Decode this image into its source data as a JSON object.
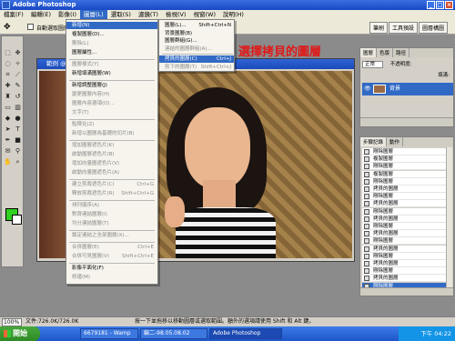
{
  "window": {
    "title": "Adobe Photoshop"
  },
  "menubar": [
    "檔案(F)",
    "編輯(E)",
    "影像(I)",
    "圖層(L)",
    "選取(S)",
    "濾鏡(T)",
    "檢視(V)",
    "視窗(W)",
    "說明(H)"
  ],
  "options": {
    "auto_select_label": "自動選取圖層",
    "tabs": [
      "筆刷",
      "工具預設",
      "圖層構圖"
    ]
  },
  "document": {
    "title": "範例 @ 100% (背景, RGB)"
  },
  "layer_menu": {
    "items": [
      {
        "label": "新增(N)",
        "shortcut": "",
        "state": "hi"
      },
      {
        "label": "複製圖層(D)...",
        "shortcut": "",
        "state": ""
      },
      {
        "label": "刪除(L)",
        "shortcut": "",
        "state": "dim"
      },
      {
        "label": "圖層屬性...",
        "shortcut": "",
        "state": ""
      },
      {
        "label": "圖層樣式(Y)",
        "shortcut": "",
        "state": "dim"
      },
      {
        "label": "新增填滿圖層(W)",
        "shortcut": "",
        "state": ""
      },
      {
        "label": "新增調整圖層(J)",
        "shortcut": "",
        "state": ""
      },
      {
        "label": "變更圖層內容(H)",
        "shortcut": "",
        "state": "dim"
      },
      {
        "label": "圖層內容選項(O)...",
        "shortcut": "",
        "state": "dim"
      },
      {
        "label": "文字(T)",
        "shortcut": "",
        "state": "dim"
      },
      {
        "label": "點陣化(Z)",
        "shortcut": "",
        "state": "dim"
      },
      {
        "label": "新增以圖層為基礎的切片(B)",
        "shortcut": "",
        "state": "dim"
      },
      {
        "label": "增加圖層遮色片(K)",
        "shortcut": "",
        "state": "dim"
      },
      {
        "label": "啟動圖層遮色片(B)",
        "shortcut": "",
        "state": "dim"
      },
      {
        "label": "增加向量圖遮色片(V)",
        "shortcut": "",
        "state": "dim"
      },
      {
        "label": "啟動向量圖遮色片(A)",
        "shortcut": "",
        "state": "dim"
      },
      {
        "label": "建立剪裁遮色片(C)",
        "shortcut": "Ctrl+G",
        "state": "dim"
      },
      {
        "label": "釋放剪裁遮色片(R)",
        "shortcut": "Shift+Ctrl+G",
        "state": "dim"
      },
      {
        "label": "排列順序(A)",
        "shortcut": "",
        "state": "dim"
      },
      {
        "label": "對齊連結圖層(I)",
        "shortcut": "",
        "state": "dim"
      },
      {
        "label": "均分連結圖層(T)",
        "shortcut": "",
        "state": "dim"
      },
      {
        "label": "鎖定連結之全部圖層(X)...",
        "shortcut": "",
        "state": "dim"
      },
      {
        "label": "合併圖層(E)",
        "shortcut": "Ctrl+E",
        "state": "dim"
      },
      {
        "label": "合併可見圖層(V)",
        "shortcut": "Shift+Ctrl+E",
        "state": "dim"
      },
      {
        "label": "影像平面化(F)",
        "shortcut": "",
        "state": ""
      },
      {
        "label": "修邊(M)",
        "shortcut": "",
        "state": "dim"
      }
    ]
  },
  "submenu": {
    "items": [
      {
        "label": "圖層(L)...",
        "shortcut": "Shift+Ctrl+N",
        "state": ""
      },
      {
        "label": "背景圖層(B)",
        "shortcut": "",
        "state": ""
      },
      {
        "label": "圖層群組(G)...",
        "shortcut": "",
        "state": ""
      },
      {
        "label": "連結的圖層群組(A)...",
        "shortcut": "",
        "state": "dim"
      },
      {
        "label": "拷貝的圖層(C)",
        "shortcut": "Ctrl+J",
        "state": "hi"
      },
      {
        "label": "剪下的圖層(T)",
        "shortcut": "Shift+Ctrl+J",
        "state": "dim"
      }
    ]
  },
  "annotation": "選擇拷貝的圖層",
  "layers_panel": {
    "tabs": [
      "圖層",
      "色版",
      "路徑"
    ],
    "blend_mode": "正常",
    "opacity_label": "不透明度:",
    "fill_label": "填滿:",
    "layer_name": "背景"
  },
  "history_panel": {
    "tabs": [
      "步驟記錄",
      "動作"
    ],
    "steps": [
      "剛除圖層",
      "複製圖層",
      "剛除圖層",
      "複製圖層",
      "剛除圖層",
      "拷貝的圖層",
      "剛除圖層",
      "拷貝的圖層",
      "剛除圖層",
      "拷貝的圖層",
      "剛除圖層",
      "拷貝的圖層",
      "剛除圖層",
      "拷貝的圖層",
      "剛除圖層",
      "拷貝的圖層",
      "剛除圖層",
      "拷貝的圖層",
      "剛除圖層"
    ]
  },
  "statusbar": {
    "zoom": "100%",
    "doc": "文件:726.0K/726.0K",
    "hint": "按一下並拖移以移動圖層或選取範圍。額外的選項請使用 Shift 和 Alt 鍵。"
  },
  "taskbar": {
    "start": "開始",
    "tasks": [
      "6679181 - Wamp",
      "編二-98.05.08.02",
      "Adobe Photoshop"
    ],
    "clock": "下午 04:22"
  }
}
